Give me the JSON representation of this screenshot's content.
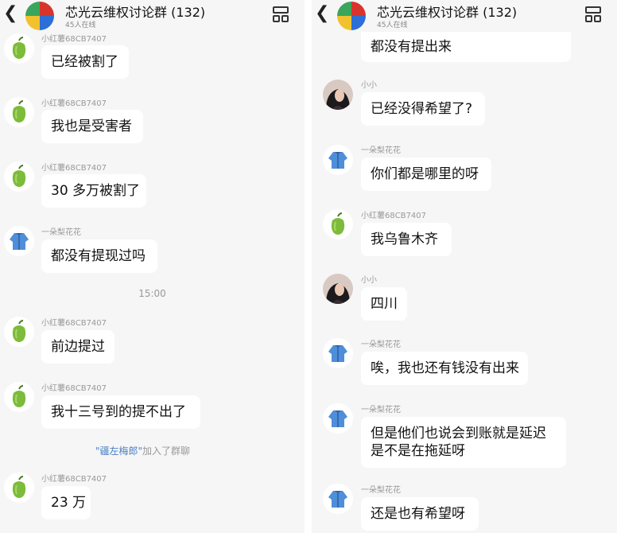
{
  "header": {
    "title": "芯光云维权讨论群 (132)",
    "subtitle": "45人在线",
    "back_icon": "chevron-left-icon",
    "menu_icon": "grid-menu-icon"
  },
  "left": {
    "messages": [
      {
        "sender": "小红薯68CB7407",
        "avatar": "green-pepper",
        "text": [
          "已经被割了"
        ]
      },
      {
        "sender": "小红薯68CB7407",
        "avatar": "green-pepper",
        "text": [
          "我也是受害者"
        ]
      },
      {
        "sender": "小红薯68CB7407",
        "avatar": "green-pepper",
        "text": [
          "30 多万被割了"
        ]
      },
      {
        "sender": "一朵梨花花",
        "avatar": "blue-jacket",
        "text": [
          "都没有提现过吗"
        ]
      },
      {
        "sender": "小红薯68CB7407",
        "avatar": "green-pepper",
        "text": [
          "前边提过"
        ]
      },
      {
        "sender": "小红薯68CB7407",
        "avatar": "green-pepper",
        "text": [
          "我十三号到的提不出了"
        ]
      },
      {
        "sender": "小红薯68CB7407",
        "avatar": "green-pepper",
        "text": [
          "23 万"
        ]
      }
    ],
    "time": "15:00",
    "join_notice": {
      "who": "\"疆左梅郎\"",
      "text": "加入了群聊"
    }
  },
  "right": {
    "partial_text": "都没有提出来",
    "messages": [
      {
        "sender": "小小",
        "avatar": "woman-photo",
        "text": [
          "已经没得希望了?"
        ]
      },
      {
        "sender": "一朵梨花花",
        "avatar": "blue-jacket",
        "text": [
          "你们都是哪里的呀"
        ]
      },
      {
        "sender": "小红薯68CB7407",
        "avatar": "green-pepper",
        "text": [
          "我乌鲁木齐"
        ]
      },
      {
        "sender": "小小",
        "avatar": "woman-photo",
        "text": [
          "四川"
        ]
      },
      {
        "sender": "一朵梨花花",
        "avatar": "blue-jacket",
        "text": [
          "唉，我也还有钱没有出来"
        ]
      },
      {
        "sender": "一朵梨花花",
        "avatar": "blue-jacket",
        "text": [
          "但是他们也说会到账就是延迟",
          "是不是在拖延呀"
        ]
      },
      {
        "sender": "一朵梨花花",
        "avatar": "blue-jacket",
        "text": [
          "还是也有希望呀"
        ]
      }
    ]
  }
}
